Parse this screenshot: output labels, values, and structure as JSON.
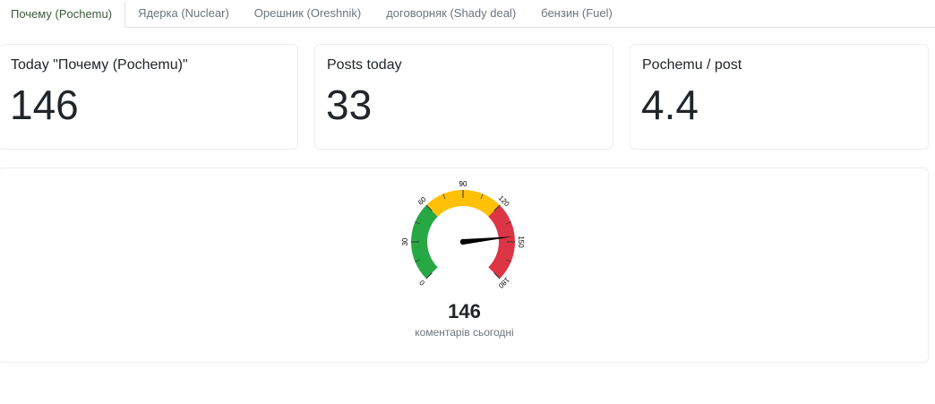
{
  "tabs": [
    {
      "label": "Почему (Pochemu)",
      "active": true
    },
    {
      "label": "Ядерка (Nuclear)",
      "active": false
    },
    {
      "label": "Орешник (Oreshnik)",
      "active": false
    },
    {
      "label": "договорняк (Shady deal)",
      "active": false
    },
    {
      "label": "бензин (Fuel)",
      "active": false
    }
  ],
  "stats": [
    {
      "title": "Today \"Почему (Pochemu)\"",
      "value": "146"
    },
    {
      "title": "Posts today",
      "value": "33"
    },
    {
      "title": "Pochemu / post",
      "value": "4.4"
    }
  ],
  "gauge": {
    "value": 146,
    "value_label": "146",
    "caption": "коментарів сьогодні",
    "min": 0,
    "max": 180,
    "tick_labels": [
      "0",
      "30",
      "60",
      "90",
      "120",
      "150",
      "180"
    ],
    "bands": [
      {
        "from": 0,
        "to": 60,
        "color": "#28a745"
      },
      {
        "from": 60,
        "to": 120,
        "color": "#ffc107"
      },
      {
        "from": 120,
        "to": 180,
        "color": "#dc3545"
      }
    ],
    "needle_color": "#000000"
  }
}
